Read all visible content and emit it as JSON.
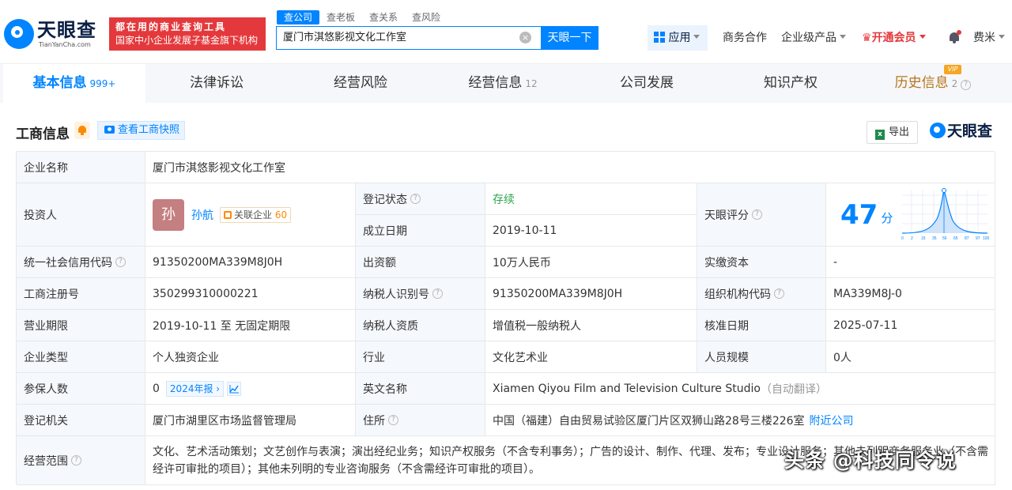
{
  "header": {
    "logo_text": "天眼查",
    "logo_sub": "TianYanCha.com",
    "slogan_line1": "都在用的商业查询工具",
    "slogan_line2": "国家中小企业发展子基金旗下机构",
    "search_tabs": [
      "查公司",
      "查老板",
      "查关系",
      "查风险"
    ],
    "search_value": "厦门市淇悠影视文化工作室",
    "search_button": "天眼一下",
    "apps_label": "应用",
    "business": "商务合作",
    "enterprise": "企业级产品",
    "vip": "开通会员",
    "user": "费米"
  },
  "tabs": [
    {
      "label": "基本信息",
      "count": "999+"
    },
    {
      "label": "法律诉讼",
      "count": ""
    },
    {
      "label": "经营风险",
      "count": ""
    },
    {
      "label": "经营信息",
      "count": "12"
    },
    {
      "label": "公司发展",
      "count": ""
    },
    {
      "label": "知识产权",
      "count": ""
    },
    {
      "label": "历史信息",
      "count": "2"
    }
  ],
  "vip_tag": "VIP",
  "section": {
    "title": "工商信息",
    "snapshot_button": "查看工商快照",
    "export_button": "导出",
    "brand": "天眼查"
  },
  "info": {
    "company_name_label": "企业名称",
    "company_name": "厦门市淇悠影视文化工作室",
    "investor_label": "投资人",
    "investor_avatar": "孙",
    "investor_name": "孙航",
    "assoc_label": "关联企业",
    "assoc_count": "60",
    "reg_status_label": "登记状态",
    "reg_status": "存续",
    "est_date_label": "成立日期",
    "est_date": "2019-10-11",
    "score_label": "天眼评分",
    "score": "47",
    "score_unit": "分",
    "score_axis": [
      "0",
      "2",
      "15",
      "35",
      "56",
      "65",
      "87",
      "97",
      "100"
    ],
    "credit_code_label": "统一社会信用代码",
    "credit_code": "91350200MA339M8J0H",
    "capital_label": "出资额",
    "capital": "10万人民币",
    "paid_capital_label": "实缴资本",
    "paid_capital": "-",
    "reg_no_label": "工商注册号",
    "reg_no": "350299310000221",
    "tax_id_label": "纳税人识别号",
    "tax_id": "91350200MA339M8J0H",
    "org_code_label": "组织机构代码",
    "org_code": "MA339M8J-0",
    "term_label": "营业期限",
    "term": "2019-10-11 至 无固定期限",
    "taxpayer_type_label": "纳税人资质",
    "taxpayer_type": "增值税一般纳税人",
    "approval_date_label": "核准日期",
    "approval_date": "2025-07-11",
    "company_type_label": "企业类型",
    "company_type": "个人独资企业",
    "industry_label": "行业",
    "industry": "文化艺术业",
    "staff_size_label": "人员规模",
    "staff_size": "0人",
    "insured_label": "参保人数",
    "insured": "0",
    "report_button": "2024年报",
    "english_name_label": "英文名称",
    "english_name": "Xiamen Qiyou Film and Television Culture Studio",
    "auto_translate": "（自动翻译）",
    "authority_label": "登记机关",
    "authority": "厦门市湖里区市场监督管理局",
    "address_label": "住所",
    "address": "中国（福建）自由贸易试验区厦门片区双狮山路28号三楼226室",
    "nearby_link": "附近公司",
    "scope_label": "经营范围",
    "scope": "文化、艺术活动策划；文艺创作与表演；演出经纪业务；知识产权服务（不含专利事务）；广告的设计、制作、代理、发布；专业设计服务；其他未列明商务服务业（不含需经许可审批的项目）；其他未列明的专业咨询服务（不含需经许可审批的项目）。"
  },
  "watermark": "头条 @科技同令说",
  "colors": {
    "brand": "#0084ff",
    "accent_red": "#e4393c",
    "status_green": "#2ea44f"
  }
}
